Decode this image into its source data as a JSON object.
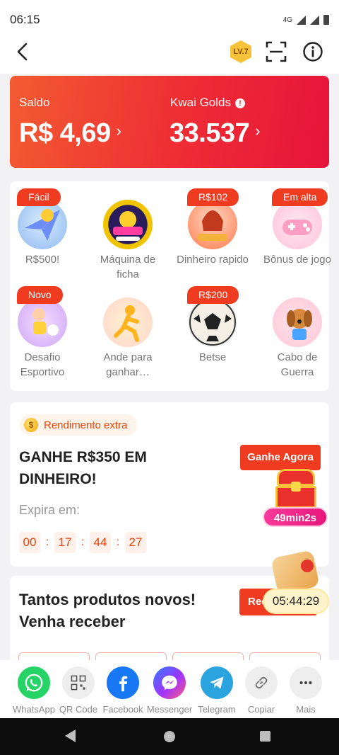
{
  "status": {
    "time": "06:15",
    "network": "4G"
  },
  "header": {
    "level_badge": "LV.7"
  },
  "balance": {
    "saldo_label": "Saldo",
    "saldo_value": "R$ 4,69",
    "golds_label": "Kwai Golds",
    "golds_value": "33.537",
    "chevron": "›",
    "info_glyph": "!"
  },
  "games": [
    {
      "tag": "Fácil",
      "name": "R$500!"
    },
    {
      "tag": "",
      "name": "Máquina de ficha"
    },
    {
      "tag": "R$102",
      "name": "Dinheiro rapido"
    },
    {
      "tag": "Em alta",
      "name": "Bônus de jogo"
    },
    {
      "tag": "Novo",
      "name": "Desafio Esportivo"
    },
    {
      "tag": "",
      "name": "Ande para ganhar…"
    },
    {
      "tag": "R$200",
      "name": "Betse"
    },
    {
      "tag": "",
      "name": "Cabo de Guerra"
    }
  ],
  "extra": {
    "pill_label": "Rendimento extra",
    "coin_glyph": "$",
    "headline": "GANHE R$350 EM DINHEIRO!",
    "button": "Ganhe Agora",
    "expira_label": "Expira em:",
    "timer": [
      "00",
      "17",
      "44",
      "27"
    ],
    "timer_sep": ":",
    "chest_countdown": "49min2s"
  },
  "products": {
    "headline": "Tantos produtos novos! Venha receber",
    "button": "Receber"
  },
  "floating_timer": "05:44:29",
  "share": [
    {
      "label": "WhatsApp",
      "icon": "whatsapp-icon",
      "color": "#25d366"
    },
    {
      "label": "QR Code",
      "icon": "qr-code-icon",
      "color": "#eeeeee"
    },
    {
      "label": "Facebook",
      "icon": "facebook-icon",
      "color": "#1877f2"
    },
    {
      "label": "Messenger",
      "icon": "messenger-icon",
      "color": "#a033ff"
    },
    {
      "label": "Telegram",
      "icon": "telegram-icon",
      "color": "#2aa3df"
    },
    {
      "label": "Copiar",
      "icon": "link-icon",
      "color": "#eeeeee"
    },
    {
      "label": "Mais",
      "icon": "more-icon",
      "color": "#eeeeee"
    }
  ]
}
